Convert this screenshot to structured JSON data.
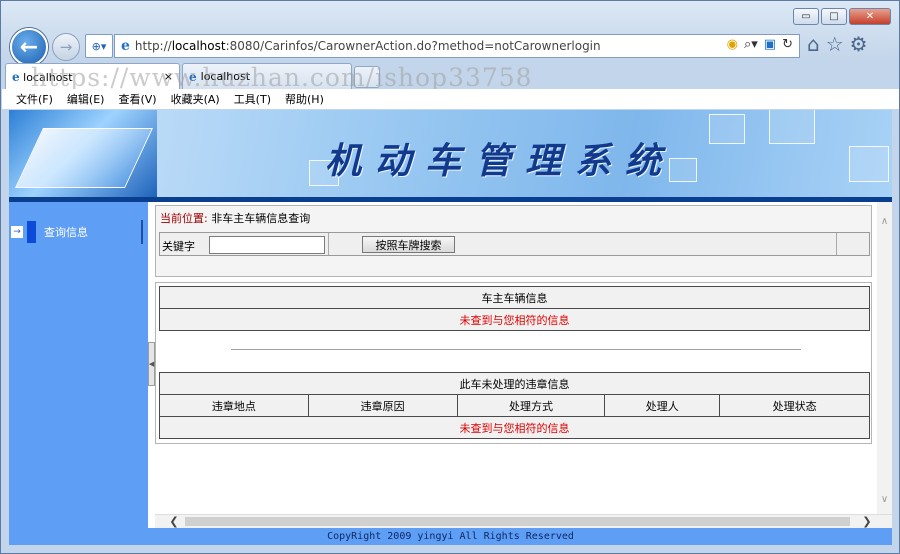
{
  "window": {
    "minimize_label": "▭",
    "maximize_label": "□",
    "close_label": "✕"
  },
  "browser": {
    "address_prefix": "http://",
    "address_host": "localhost",
    "address_rest": ":8080/Carinfos/CarownerAction.do?method=notCarownerlogin",
    "tabs": [
      {
        "title": "localhost",
        "active": true,
        "close": "×"
      },
      {
        "title": "localhost",
        "active": false
      }
    ],
    "menu": [
      "文件(F)",
      "编辑(E)",
      "查看(V)",
      "收藏夹(A)",
      "工具(T)",
      "帮助(H)"
    ]
  },
  "watermark": "https://www.huzhan.com/ishop33758",
  "banner": {
    "title": "机动车管理系统"
  },
  "sidebar": {
    "items": [
      {
        "label": "查询信息"
      }
    ]
  },
  "location": {
    "label": "当前位置:",
    "value": "非车主车辆信息查询"
  },
  "search": {
    "keyword_label": "关键字",
    "keyword_value": "",
    "button_label": "按照车牌搜索"
  },
  "vehicle_table": {
    "title": "车主车辆信息",
    "empty_message": "未查到与您相符的信息"
  },
  "violation_table": {
    "title": "此车未处理的违章信息",
    "columns": [
      "违章地点",
      "违章原因",
      "处理方式",
      "处理人",
      "处理状态"
    ],
    "empty_message": "未查到与您相符的信息"
  },
  "footer": {
    "text": "CopyRight 2009 yingyi All Rights Reserved"
  },
  "colors": {
    "sidebar": "#5f9ef5",
    "accent": "#0a3f8f",
    "empty_text": "#e00000",
    "location_label": "#a00000"
  }
}
